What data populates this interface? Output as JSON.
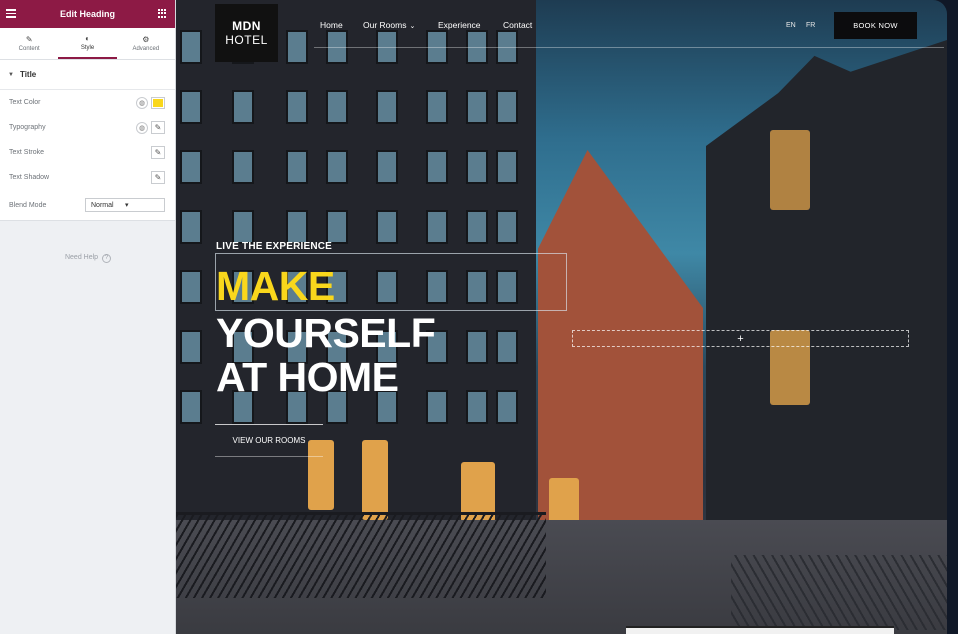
{
  "editor": {
    "title": "Edit Heading",
    "icons": {
      "menu": "hamburger-icon",
      "widgets": "grid-icon"
    },
    "tabs": [
      {
        "label": "Content",
        "icon": "pencil-icon",
        "glyph": "✎"
      },
      {
        "label": "Style",
        "icon": "half-circle-icon",
        "glyph": "◐",
        "active": true
      },
      {
        "label": "Advanced",
        "icon": "gear-icon",
        "glyph": "⚙"
      }
    ],
    "section_title": "Title",
    "controls": {
      "text_color": {
        "label": "Text Color",
        "value": "#F9D71C"
      },
      "typography": {
        "label": "Typography"
      },
      "text_stroke": {
        "label": "Text Stroke"
      },
      "text_shadow": {
        "label": "Text Shadow"
      },
      "blend_mode": {
        "label": "Blend Mode",
        "value": "Normal"
      }
    },
    "need_help": "Need Help",
    "accent": "#8D1A45"
  },
  "site": {
    "logo_line1": "MDN",
    "logo_line2": "HOTEL",
    "nav": [
      "Home",
      "Our Rooms",
      "Experience",
      "Contact"
    ],
    "languages": [
      "EN",
      "FR"
    ],
    "book_now": "BOOK NOW",
    "eyebrow": "LIVE THE EXPERIENCE",
    "headline": [
      "MAKE",
      "YOURSELF",
      "AT HOME"
    ],
    "headline_accent": "#F9D71C",
    "cta": "VIEW OUR ROOMS",
    "add_section": "+"
  }
}
